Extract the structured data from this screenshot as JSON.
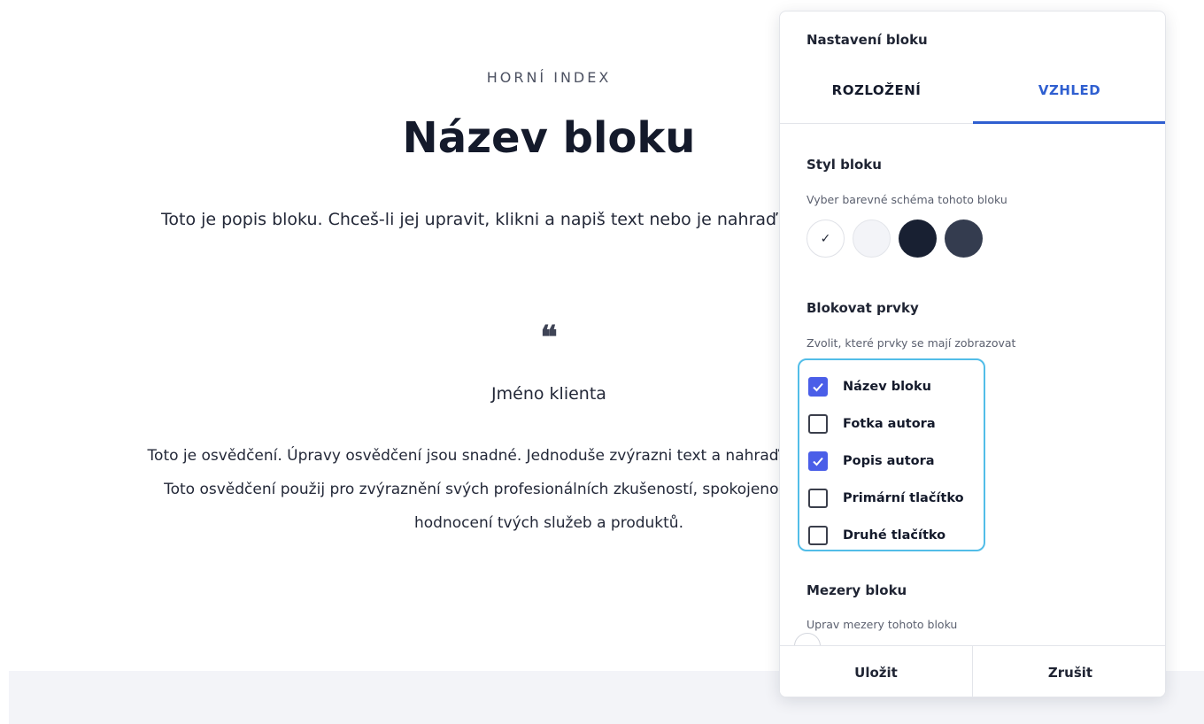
{
  "block": {
    "overline": "HORNÍ INDEX",
    "title": "Název bloku",
    "description": "Toto je popis bloku. Chceš-li jej upravit, klikni a napiš text nebo je nahraď vlastním obsahem",
    "quote_mark": "❝",
    "client_name": "Jméno klienta",
    "testimonial": "Toto je osvědčení. Úpravy osvědčení jsou snadné. Jednoduše zvýrazni text a nahraď ho vlastním obsahem. Toto osvědčení použij pro zvýraznění svých profesionálních zkušeností, spokojenosti zákazníků a jejich hodnocení tvých služeb a produktů."
  },
  "panel": {
    "title": "Nastavení bloku",
    "tabs": [
      {
        "label": "ROZLOŽENÍ",
        "active": false
      },
      {
        "label": "VZHLED",
        "active": true
      }
    ],
    "style_section": {
      "title": "Styl bloku",
      "hint": "Vyber barevné schéma tohoto bloku",
      "selected_mark": "✓",
      "swatches": [
        {
          "color": "#ffffff",
          "selected": true
        },
        {
          "color": "#f3f4f8",
          "selected": false
        },
        {
          "color": "#182032",
          "selected": false
        },
        {
          "color": "#343c4f",
          "selected": false
        }
      ]
    },
    "elements_section": {
      "title": "Blokovat prvky",
      "hint": "Zvolit, které prvky se mají zobrazovat",
      "items": [
        {
          "label": "Název bloku",
          "checked": true
        },
        {
          "label": "Fotka autora",
          "checked": false
        },
        {
          "label": "Popis autora",
          "checked": true
        },
        {
          "label": "Primární tlačítko",
          "checked": false
        },
        {
          "label": "Druhé tlačítko",
          "checked": false
        }
      ]
    },
    "spacing_section": {
      "title": "Mezery bloku",
      "hint": "Uprav mezery tohoto bloku"
    },
    "footer": {
      "save_label": "Uložit",
      "cancel_label": "Zrušit"
    }
  },
  "colors": {
    "accent": "#2f5fd0",
    "checkbox_on": "#4a5ee8",
    "focus_ring": "#52bde8"
  }
}
